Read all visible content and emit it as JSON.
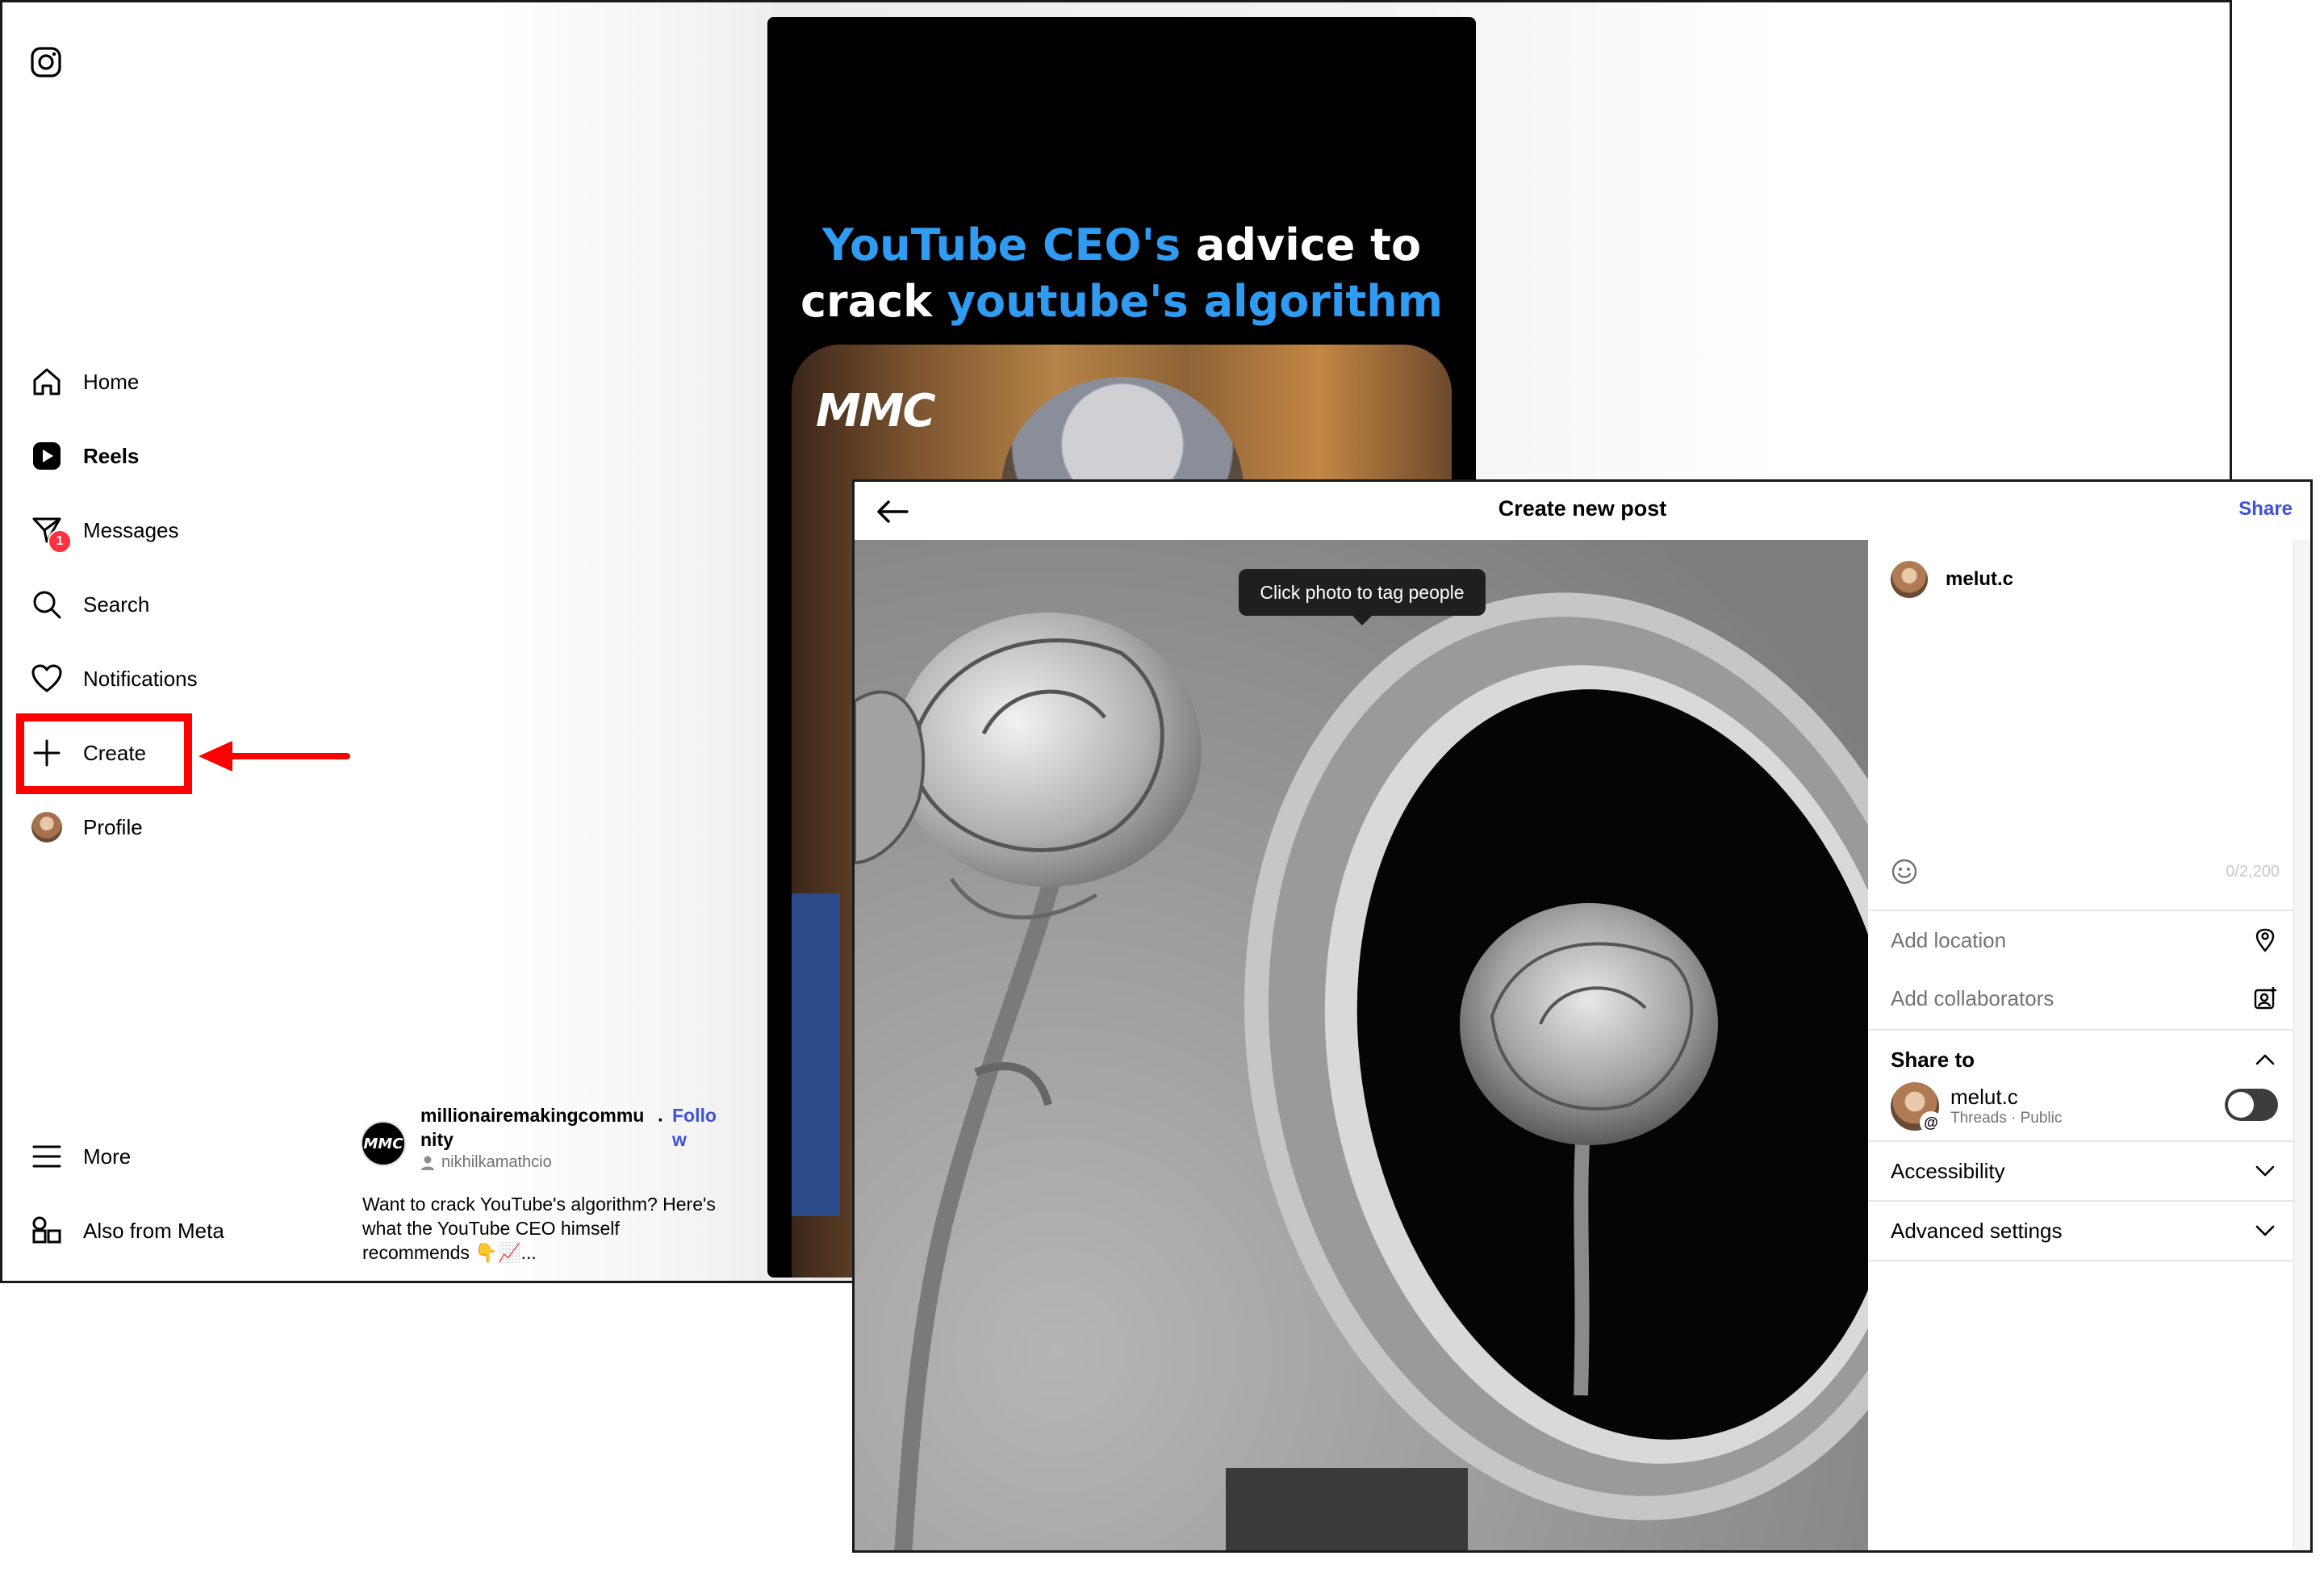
{
  "sidebar": {
    "items": [
      {
        "label": "Home",
        "icon": "home-icon"
      },
      {
        "label": "Reels",
        "icon": "reels-icon"
      },
      {
        "label": "Messages",
        "icon": "messages-icon",
        "badge": "1"
      },
      {
        "label": "Search",
        "icon": "search-icon"
      },
      {
        "label": "Notifications",
        "icon": "heart-icon"
      },
      {
        "label": "Create",
        "icon": "plus-icon"
      },
      {
        "label": "Profile",
        "icon": "avatar"
      }
    ],
    "more_label": "More",
    "meta_label": "Also from Meta"
  },
  "reel": {
    "title_part1": "YouTube CEO's",
    "title_part2": " advice to",
    "title_part3": "crack ",
    "title_part4": "youtube's algorithm",
    "watermark": "MMC",
    "caption": {
      "avatar_text": "MMC",
      "username": "millionairemakingcommunity",
      "follow_label": "Follow",
      "audio": "nikhilkamathcio",
      "text": "Want to crack YouTube's algorithm? Here's what the YouTube CEO himself recommends 👇📈..."
    }
  },
  "modal": {
    "title": "Create new post",
    "share_label": "Share",
    "tooltip": "Click photo to tag people",
    "author": "melut.c",
    "char_count": "0/2,200",
    "add_location": "Add location",
    "add_collaborators": "Add collaborators",
    "share_to": "Share to",
    "threads_name": "melut.c",
    "threads_sub": "Threads · Public",
    "accessibility": "Accessibility",
    "advanced_settings": "Advanced settings"
  },
  "colors": {
    "accent_blue": "#3f51d8",
    "highlight_red": "#ff0000",
    "badge_red": "#ff3040",
    "reel_blue": "#2f9bf2"
  }
}
